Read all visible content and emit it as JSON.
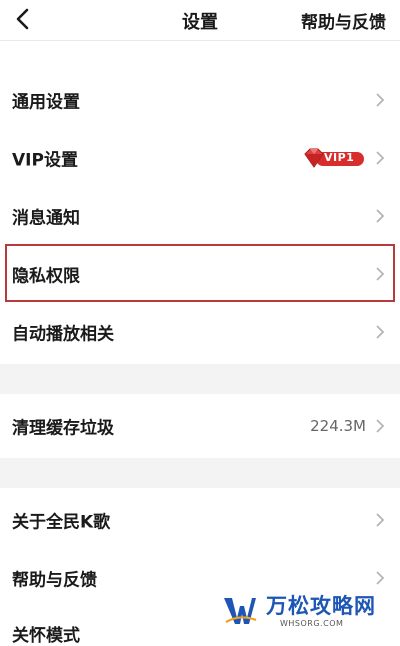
{
  "header": {
    "title": "设置",
    "help_link": "帮助与反馈"
  },
  "sections": [
    {
      "items": [
        {
          "label": "通用设置"
        },
        {
          "label": "VIP设置",
          "badge": "VIP1"
        },
        {
          "label": "消息通知"
        },
        {
          "label": "隐私权限",
          "highlighted": true
        },
        {
          "label": "自动播放相关"
        }
      ]
    },
    {
      "items": [
        {
          "label": "清理缓存垃圾",
          "value": "224.3M"
        }
      ]
    },
    {
      "items": [
        {
          "label": "关于全民K歌"
        },
        {
          "label": "帮助与反馈"
        },
        {
          "label": "关怀模式"
        }
      ]
    }
  ],
  "watermark": {
    "name": "万松攻略网",
    "domain": "WHSORG.COM"
  },
  "colors": {
    "highlight": "#b93a3a",
    "vip_red": "#d72d2d",
    "watermark_blue": "#1e56b5"
  }
}
